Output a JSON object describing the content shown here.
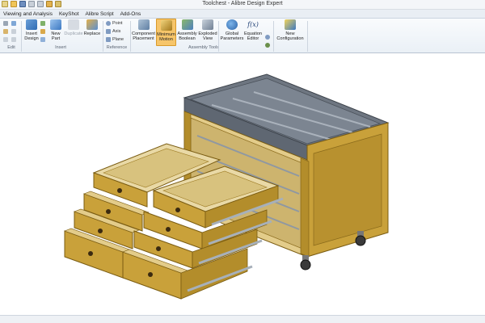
{
  "window": {
    "title": "Toolchest - Alibre Design Expert"
  },
  "menu": {
    "tabs": [
      "Viewing and Analysis",
      "KeyShot",
      "Alibre Script",
      "Add-Ons"
    ]
  },
  "ribbon": {
    "groups": {
      "edit": "Edit",
      "insert": "Insert",
      "reference": "Reference",
      "assembly_tools": "Assembly Tools"
    },
    "buttons": {
      "insert_design": [
        "Insert",
        "Design"
      ],
      "new_part": [
        "New",
        "Part"
      ],
      "duplicate": "Duplicate",
      "replace": "Replace",
      "point": "Point",
      "axis": "Axis",
      "plane": "Plane",
      "component_placement": [
        "Component",
        "Placement"
      ],
      "minimum_motion": [
        "Minimum",
        "Motion"
      ],
      "assembly_boolean": [
        "Assembly",
        "Boolean"
      ],
      "exploded_view": [
        "Exploded",
        "View"
      ],
      "global_parameters": [
        "Global",
        "Parameters"
      ],
      "equation_editor": [
        "Equation",
        "Editor"
      ],
      "new_configuration": [
        "New",
        "Configuration"
      ]
    },
    "icons": {
      "equation": "f(x)"
    }
  },
  "viewport": {
    "model": "toolchest-3d-model",
    "colors": {
      "wood": "#c9a43d",
      "wood_dark": "#9c7a22",
      "top": "#6d7480",
      "rail": "#9aa3ad",
      "drawer_inner": "#e9d9a6"
    }
  }
}
